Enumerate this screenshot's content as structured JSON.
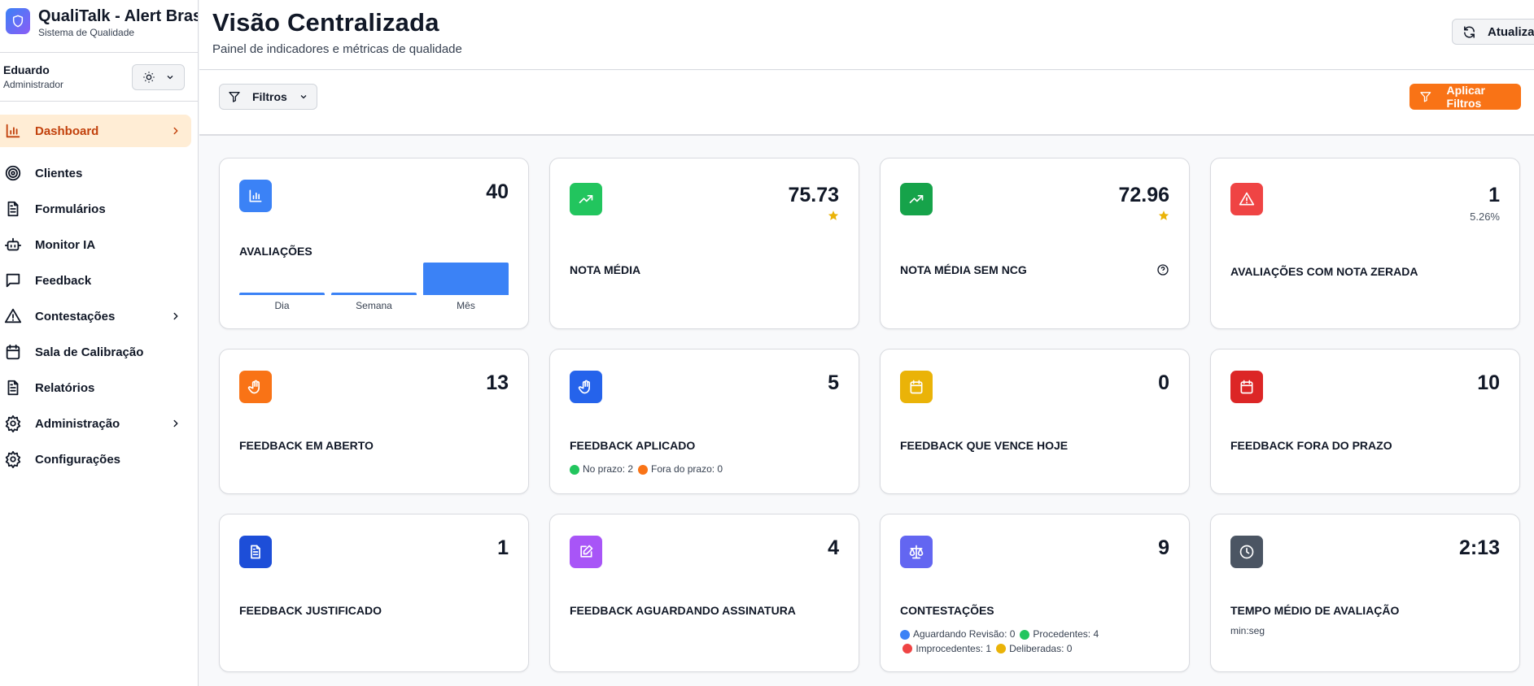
{
  "sidebar": {
    "app_title": "QualiTalk - Alert Brasil",
    "app_subtitle": "Sistema de Qualidade",
    "user_name": "Eduardo",
    "user_role": "Administrador",
    "items": [
      {
        "label": "Dashboard",
        "icon": "bar-chart-icon",
        "active": true,
        "chevron": true
      },
      {
        "label": "Clientes",
        "icon": "target-icon"
      },
      {
        "label": "Formulários",
        "icon": "file-text-icon"
      },
      {
        "label": "Monitor IA",
        "icon": "bot-icon"
      },
      {
        "label": "Feedback",
        "icon": "message-square-icon"
      },
      {
        "label": "Contestações",
        "icon": "alert-triangle-icon",
        "chevron": true
      },
      {
        "label": "Sala de Calibração",
        "icon": "calendar-icon"
      },
      {
        "label": "Relatórios",
        "icon": "file-text-icon"
      },
      {
        "label": "Administração",
        "icon": "gear-icon",
        "chevron": true
      },
      {
        "label": "Configurações",
        "icon": "gear-icon"
      }
    ]
  },
  "header": {
    "title": "Visão Centralizada",
    "subtitle": "Painel de indicadores e métricas de qualidade",
    "refresh_label": "Atualizar"
  },
  "filters": {
    "filters_label": "Filtros",
    "apply_label": "Aplicar Filtros"
  },
  "colors": {
    "accent": "#f97316",
    "active_bg": "#ffedd5",
    "active_text": "#c2410c"
  },
  "cards": [
    {
      "label": "AVALIAÇÕES",
      "value": "40",
      "icon": "bar-chart-icon",
      "color": "#3b82f6",
      "mini_chart": {
        "categories": [
          "Dia",
          "Semana",
          "Mês"
        ],
        "values": [
          0,
          0,
          40
        ]
      }
    },
    {
      "label": "NOTA MÉDIA",
      "value": "75.73",
      "icon": "trending-up-icon",
      "color": "#22c55e",
      "star": true
    },
    {
      "label": "NOTA MÉDIA SEM NCG",
      "value": "72.96",
      "icon": "trending-up-icon",
      "color": "#16a34a",
      "star": true,
      "help": true
    },
    {
      "label": "AVALIAÇÕES COM NOTA ZERADA",
      "value": "1",
      "sub": "5.26%",
      "icon": "alert-triangle-icon",
      "color": "#ef4444"
    },
    {
      "label": "FEEDBACK EM ABERTO",
      "value": "13",
      "icon": "hand-icon",
      "color": "#f97316"
    },
    {
      "label": "FEEDBACK APLICADO",
      "value": "5",
      "icon": "hand-icon",
      "color": "#2563eb",
      "legend": [
        {
          "text": "No prazo: 2",
          "color": "#22c55e"
        },
        {
          "text": "Fora do prazo: 0",
          "color": "#f97316"
        }
      ]
    },
    {
      "label": "FEEDBACK QUE VENCE HOJE",
      "value": "0",
      "icon": "calendar-icon",
      "color": "#eab308"
    },
    {
      "label": "FEEDBACK FORA DO PRAZO",
      "value": "10",
      "icon": "calendar-icon",
      "color": "#dc2626"
    },
    {
      "label": "FEEDBACK JUSTIFICADO",
      "value": "1",
      "icon": "file-text-icon",
      "color": "#1d4ed8"
    },
    {
      "label": "FEEDBACK AGUARDANDO ASSINATURA",
      "value": "4",
      "icon": "edit-icon",
      "color": "#a855f7"
    },
    {
      "label": "CONTESTAÇÕES",
      "value": "9",
      "icon": "scale-icon",
      "color": "#6366f1",
      "legend": [
        {
          "text": "Aguardando Revisão: 0",
          "color": "#3b82f6"
        },
        {
          "text": "Procedentes: 4",
          "color": "#22c55e"
        },
        {
          "text": "Improcedentes: 1",
          "color": "#ef4444"
        },
        {
          "text": "Deliberadas: 0",
          "color": "#eab308"
        }
      ]
    },
    {
      "label": "TEMPO MÉDIO DE AVALIAÇÃO",
      "value": "2:13",
      "note": "min:seg",
      "icon": "clock-icon",
      "color": "#4b5563"
    }
  ]
}
